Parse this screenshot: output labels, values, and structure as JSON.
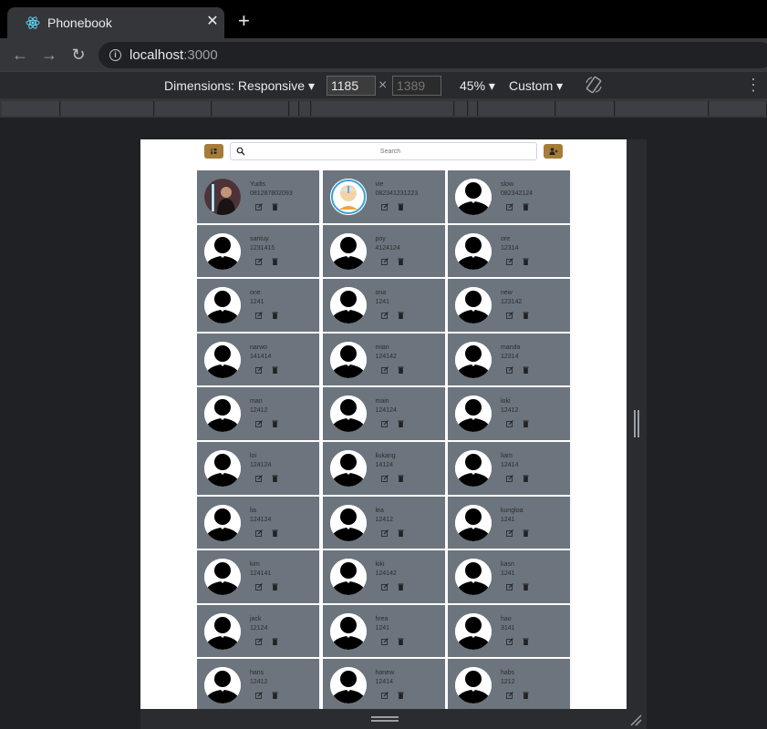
{
  "browser": {
    "tab_title": "Phonebook",
    "tab_close": "✕",
    "new_tab": "+",
    "url_host": "localhost",
    "url_port": ":3000"
  },
  "devtools": {
    "dimensions_label": "Dimensions: Responsive ▾",
    "width_value": "1185",
    "height_placeholder": "1389",
    "times": "×",
    "zoom_label": "45% ▾",
    "throttle_label": "Custom ▾"
  },
  "app": {
    "search_placeholder": "Search",
    "accent_color": "#a67c3a",
    "card_color": "#6c757d"
  },
  "contacts": [
    {
      "name": "Yudis",
      "phone": "081287802093",
      "avatar": "photo-jedi"
    },
    {
      "name": "vie",
      "phone": "082341231223",
      "avatar": "photo-cartoon"
    },
    {
      "name": "slow",
      "phone": "082342124",
      "avatar": "default"
    },
    {
      "name": "santuy",
      "phone": "1231415",
      "avatar": "default"
    },
    {
      "name": "poy",
      "phone": "4124124",
      "avatar": "default"
    },
    {
      "name": "ore",
      "phone": "12314",
      "avatar": "default"
    },
    {
      "name": "one",
      "phone": "1241",
      "avatar": "default"
    },
    {
      "name": "ona",
      "phone": "1241",
      "avatar": "default"
    },
    {
      "name": "new",
      "phone": "123142",
      "avatar": "default"
    },
    {
      "name": "narwo",
      "phone": "141414",
      "avatar": "default"
    },
    {
      "name": "mian",
      "phone": "124142",
      "avatar": "default"
    },
    {
      "name": "manda",
      "phone": "12314",
      "avatar": "default"
    },
    {
      "name": "man",
      "phone": "12412",
      "avatar": "default"
    },
    {
      "name": "main",
      "phone": "124124",
      "avatar": "default"
    },
    {
      "name": "loki",
      "phone": "12412",
      "avatar": "default"
    },
    {
      "name": "loi",
      "phone": "124124",
      "avatar": "default"
    },
    {
      "name": "liukang",
      "phone": "14124",
      "avatar": "default"
    },
    {
      "name": "liam",
      "phone": "12414",
      "avatar": "default"
    },
    {
      "name": "lia",
      "phone": "124124",
      "avatar": "default"
    },
    {
      "name": "lea",
      "phone": "12412",
      "avatar": "default"
    },
    {
      "name": "kungloa",
      "phone": "1241",
      "avatar": "default"
    },
    {
      "name": "kim",
      "phone": "124141",
      "avatar": "default"
    },
    {
      "name": "kiki",
      "phone": "124142",
      "avatar": "default"
    },
    {
      "name": "kasn",
      "phone": "1241",
      "avatar": "default"
    },
    {
      "name": "jack",
      "phone": "12124",
      "avatar": "default"
    },
    {
      "name": "hrea",
      "phone": "1241",
      "avatar": "default"
    },
    {
      "name": "hao",
      "phone": "3141",
      "avatar": "default"
    },
    {
      "name": "hans",
      "phone": "12412",
      "avatar": "default"
    },
    {
      "name": "hanew",
      "phone": "12414",
      "avatar": "default"
    },
    {
      "name": "habs",
      "phone": "1212",
      "avatar": "default"
    }
  ]
}
